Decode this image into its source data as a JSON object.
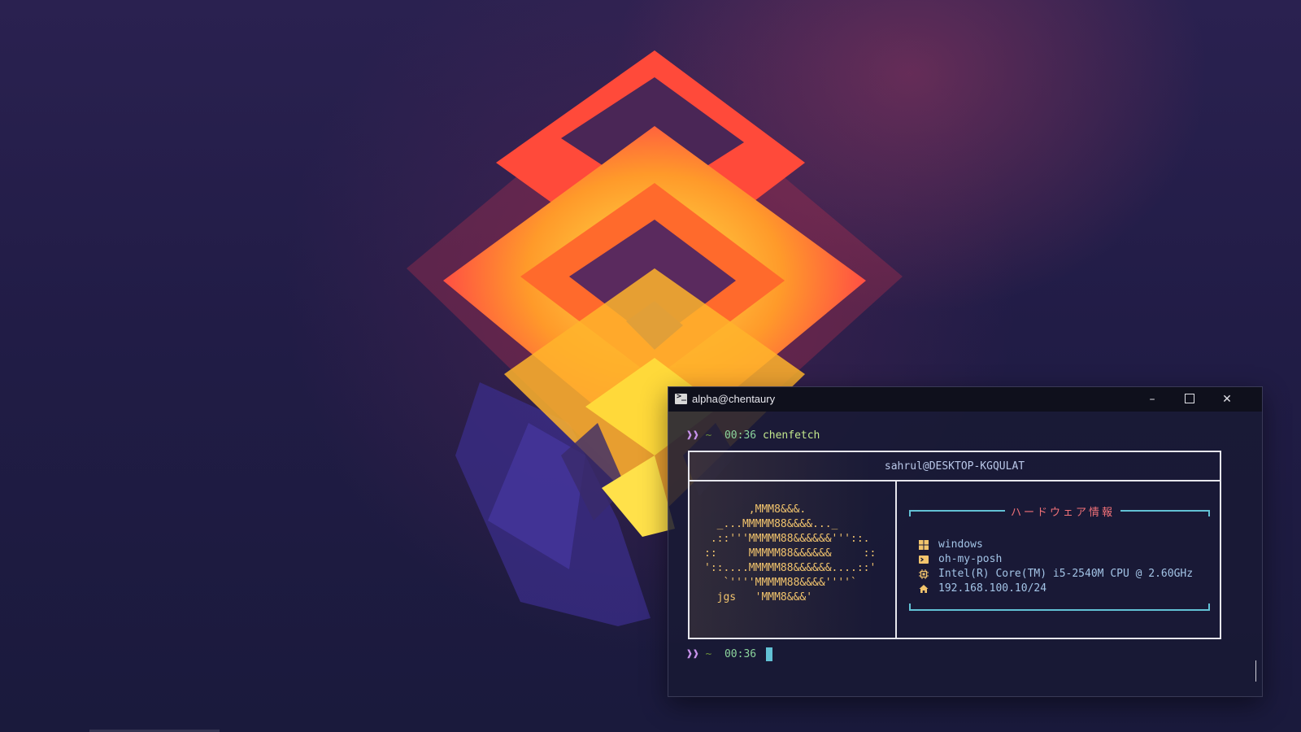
{
  "terminal": {
    "title": "alpha@chentaury",
    "window_buttons": {
      "minimize": "–",
      "close": "✕"
    },
    "prompt": {
      "arrows": "❱❱",
      "dir": "~"
    },
    "line1": {
      "time": "00:36",
      "command": "chenfetch"
    },
    "line2": {
      "time": "00:36"
    }
  },
  "fetch": {
    "userhost": "sahrul@DESKTOP-KGQULAT",
    "ascii_art": "       ,MMM8&&&.\n  _...MMMMM88&&&&..._\n .::'''MMMMM88&&&&&&'''::.\n::     MMMMM88&&&&&&     ::\n'::....MMMMM88&&&&&&....::'\n   `''''MMMMM88&&&&''''`\n  jgs   'MMM8&&&'",
    "hardware_title": "ハードウェア情報",
    "hardware": [
      {
        "icon": "windows-icon",
        "label": "windows"
      },
      {
        "icon": "terminal-icon",
        "label": "oh-my-posh"
      },
      {
        "icon": "cpu-icon",
        "label": "Intel(R) Core(TM) i5-2540M CPU @ 2.60GHz"
      },
      {
        "icon": "home-icon",
        "label": "192.168.100.10/24"
      }
    ]
  },
  "colors": {
    "accent_cyan": "#62c1d5",
    "ascii_gold": "#f2c46d",
    "title_pink": "#f07178",
    "prompt_purple": "#c792ea"
  }
}
